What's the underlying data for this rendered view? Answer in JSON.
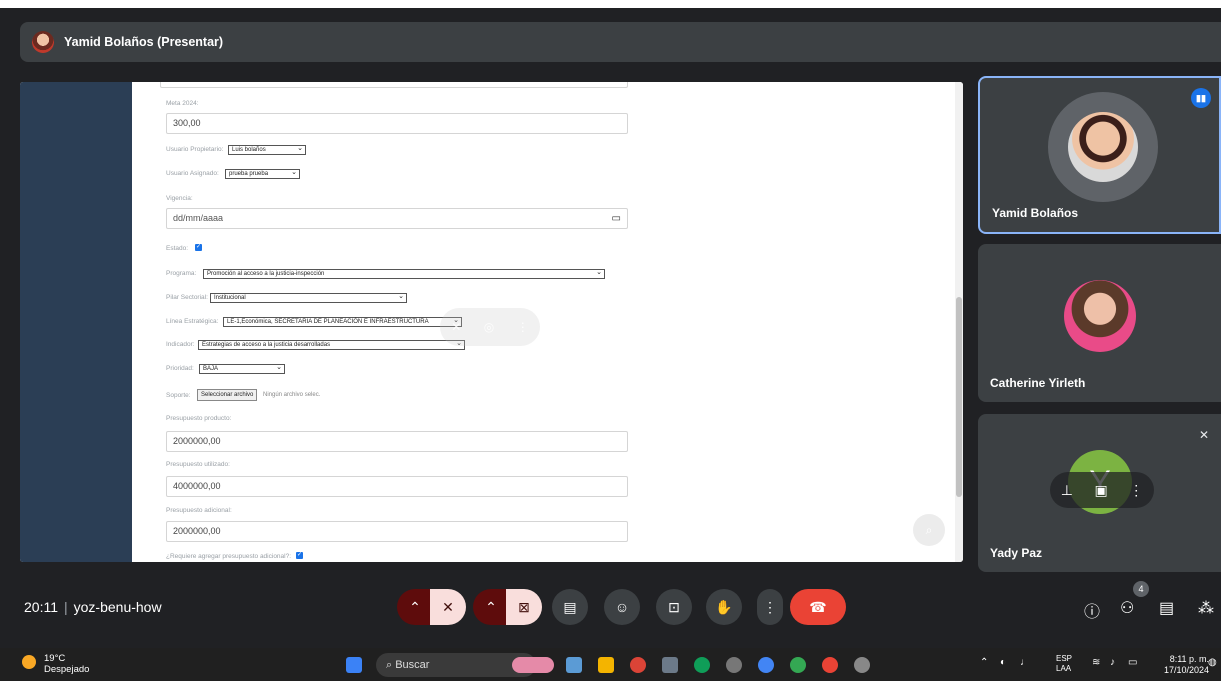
{
  "presenter": {
    "title": "Yamid Bolaños (Presentar)"
  },
  "form": {
    "meta_label": "Meta 2024:",
    "meta_value": "300,00",
    "owner_label": "Usuario Propietario:",
    "owner_value": "Luis bolaños",
    "assigned_label": "Usuario Asignado:",
    "assigned_value": "prueba prueba",
    "validity_label": "Vigencia:",
    "validity_placeholder": "dd/mm/aaaa",
    "state_label": "Estado:",
    "program_label": "Programa:",
    "program_value": "Promoción al acceso a la justicia-inspección",
    "pillar_label": "Pilar Sectorial:",
    "pillar_value": "Institucional",
    "line_label": "Línea Estratégica:",
    "line_value": "LE-1,Económica, SECRETARIA DE PLANEACIÓN E INFRAESTRUCTURA",
    "indicator_label": "Indicador:",
    "indicator_value": "Estrategias de acceso a la justicia desarrolladas",
    "priority_label": "Prioridad:",
    "priority_value": "BAJA",
    "support_label": "Soporte:",
    "file_button": "Seleccionar archivo",
    "file_none": "Ningún archivo selec.",
    "budget_product_label": "Presupuesto producto:",
    "budget_product_value": "2000000,00",
    "budget_used_label": "Presupuesto utilizado:",
    "budget_used_value": "4000000,00",
    "budget_extra_label": "Presupuesto adicional:",
    "budget_extra_value": "2000000,00",
    "requires_extra_label": "¿Requiere agregar presupuesto adicional?:"
  },
  "participants": [
    {
      "name": "Yamid Bolaños"
    },
    {
      "name": "Catherine Yirleth"
    },
    {
      "name": "Yady Paz",
      "initial": "Y"
    }
  ],
  "meeting": {
    "time": "20:11",
    "code": "yoz-benu-how",
    "people_count": "4"
  },
  "taskbar": {
    "temp": "19°C",
    "weather": "Despejado",
    "search": "Buscar",
    "lang1": "ESP",
    "lang2": "LAA",
    "time": "8:11 p. m.",
    "date": "17/10/2024"
  }
}
